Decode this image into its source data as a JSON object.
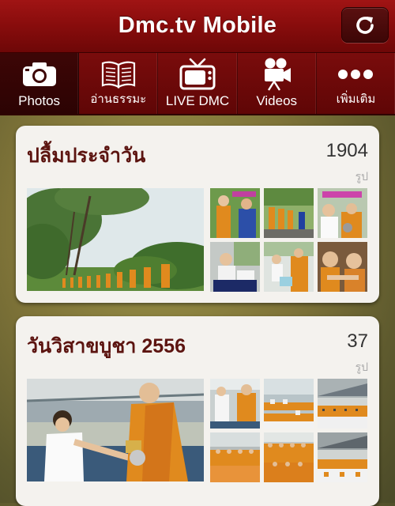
{
  "header": {
    "title": "Dmc.tv Mobile",
    "refresh_icon": "refresh-icon"
  },
  "tabs": [
    {
      "label": "Photos",
      "icon": "camera-icon",
      "active": true
    },
    {
      "label": "อ่านธรรมะ",
      "icon": "book-icon",
      "active": false
    },
    {
      "label": "LIVE DMC",
      "icon": "tv-icon",
      "active": false
    },
    {
      "label": "Videos",
      "icon": "video-camera-icon",
      "active": false
    },
    {
      "label": "เพิ่มเติม",
      "icon": "more-icon",
      "active": false
    }
  ],
  "albums": [
    {
      "title": "ปลื้มประจำวัน",
      "count": "1904",
      "unit": "รูป",
      "thumb_count": 6
    },
    {
      "title": "วันวิสาขบูชา 2556",
      "count": "37",
      "unit": "รูป",
      "thumb_count": 6
    }
  ],
  "colors": {
    "header_red": "#8a0d0d",
    "tab_active": "#3d0606",
    "card_bg": "#f4f2ee",
    "title_color": "#5c1410",
    "monk_robe": "#e08a1e"
  }
}
